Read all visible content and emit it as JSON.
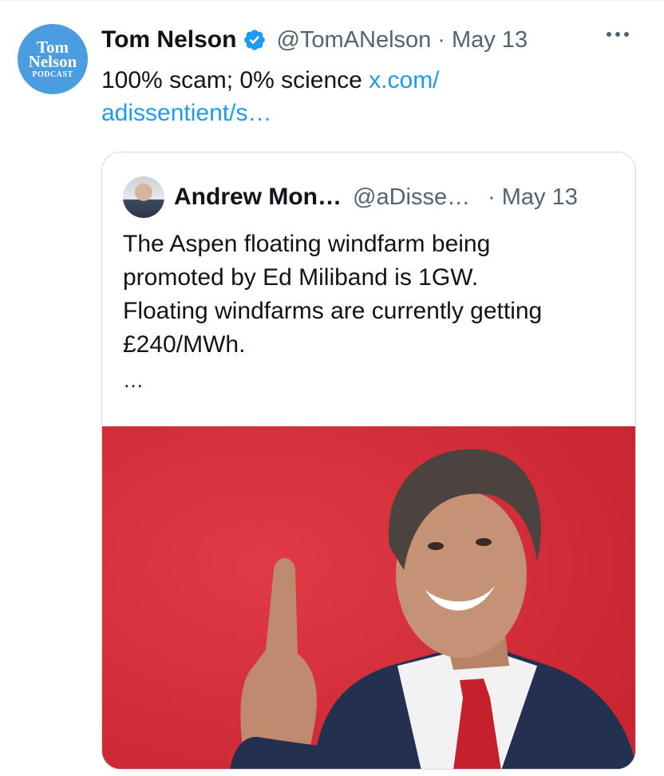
{
  "tweet": {
    "avatar": {
      "line1": "Tom",
      "line2": "Nelson",
      "line3": "PODCAST",
      "color": "#4a9de0"
    },
    "author_name": "Tom Nelson",
    "verified_icon": "verified-badge-icon",
    "handle": "@TomANelson",
    "separator": "·",
    "date": "May 13",
    "more_icon": "more-options-icon",
    "text": "100% scam; 0% science",
    "link_text": "x.com/\nadissentient/s…",
    "link_line1": "x.com/",
    "link_line2": "adissentient/s…"
  },
  "quote": {
    "author_name": "Andrew Mon…",
    "handle": "@aDisse…",
    "separator": "·",
    "date": "May 13",
    "text": "The Aspen floating windfarm being\npromoted by Ed Miliband is 1GW.\nFloating windfarms are currently getting\n£240/MWh.",
    "ellipsis": "…",
    "image_background": "#d92f3b"
  },
  "colors": {
    "text_primary": "#0f1419",
    "text_secondary": "#536471",
    "link": "#1d9bf0",
    "border": "#cfd9de"
  }
}
